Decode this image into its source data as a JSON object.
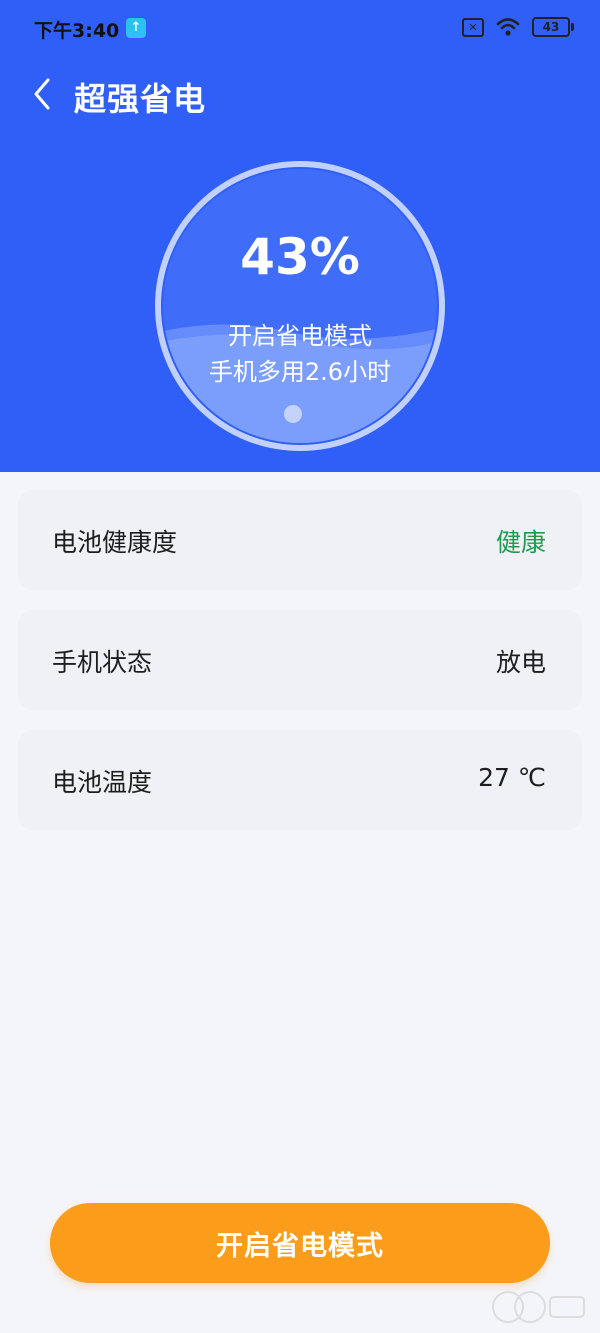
{
  "status_bar": {
    "time": "下午3:40",
    "upload_icon": "↑",
    "sim_icon": "✕",
    "battery": "43"
  },
  "header": {
    "title": "超强省电",
    "back_icon": "chevron-left-icon"
  },
  "battery_ring": {
    "percent_text": "43%",
    "percent_value": 43,
    "mode_text": "开启省电模式",
    "extra_time_text": "手机多用2.6小时"
  },
  "info_cards": [
    {
      "label": "电池健康度",
      "value": "健康",
      "value_color": "#1e9c4d"
    },
    {
      "label": "手机状态",
      "value": "放电"
    },
    {
      "label": "电池温度",
      "value": "27 ℃"
    }
  ],
  "action": {
    "button_label": "开启省电模式"
  },
  "colors": {
    "header_bg": "#2f5ff7",
    "button_bg": "#fb9d1b",
    "page_bg": "#f4f5fa",
    "healthy_green": "#1e9c4d"
  }
}
